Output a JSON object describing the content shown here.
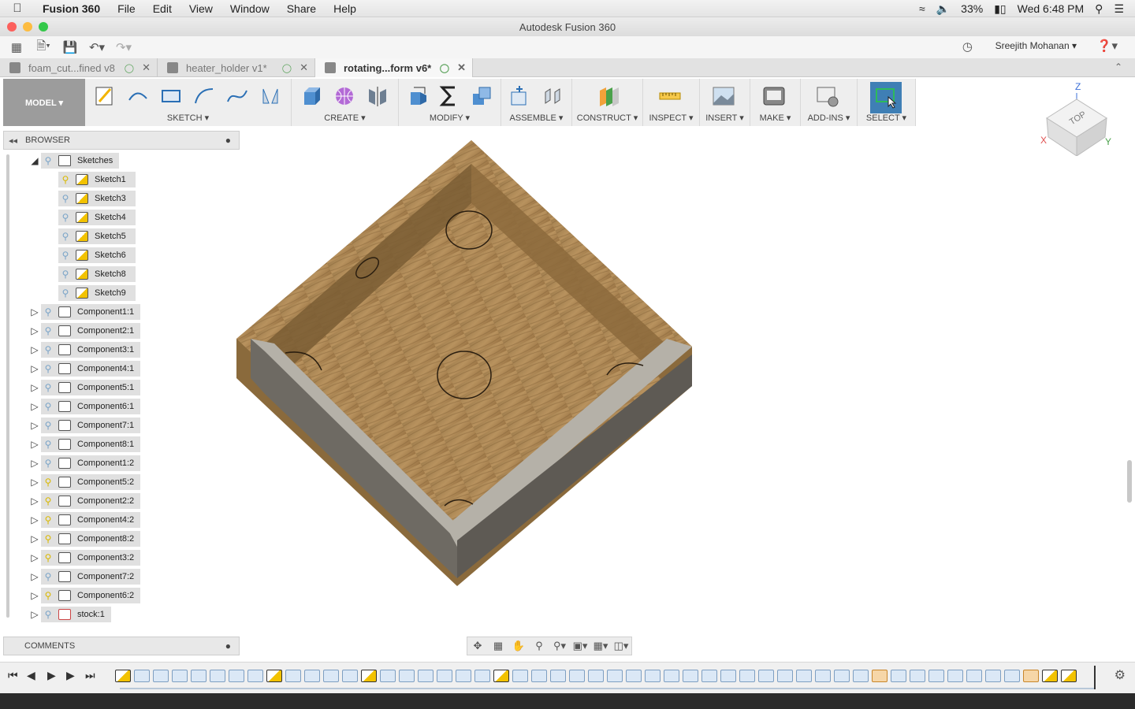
{
  "menubar": {
    "app_name": "Fusion 360",
    "items": [
      "File",
      "Edit",
      "View",
      "Window",
      "Share",
      "Help"
    ],
    "battery": "33%",
    "clock": "Wed 6:48 PM"
  },
  "window": {
    "title": "Autodesk Fusion 360"
  },
  "user": {
    "name": "Sreejith Mohanan ▾"
  },
  "tabs": [
    {
      "label": "foam_cut...fined v8"
    },
    {
      "label": "heater_holder v1*"
    },
    {
      "label": "rotating...form v6*"
    }
  ],
  "ribbon": {
    "workspace": "MODEL ▾",
    "groups": [
      {
        "label": "SKETCH ▾"
      },
      {
        "label": "CREATE ▾"
      },
      {
        "label": "MODIFY ▾"
      },
      {
        "label": "ASSEMBLE ▾"
      },
      {
        "label": "CONSTRUCT ▾"
      },
      {
        "label": "INSPECT ▾"
      },
      {
        "label": "INSERT ▾"
      },
      {
        "label": "MAKE ▾"
      },
      {
        "label": "ADD-INS ▾"
      },
      {
        "label": "SELECT ▾"
      }
    ]
  },
  "browser": {
    "title": "BROWSER",
    "folder": "Sketches",
    "sketches": [
      "Sketch1",
      "Sketch3",
      "Sketch4",
      "Sketch5",
      "Sketch6",
      "Sketch8",
      "Sketch9"
    ],
    "components": [
      {
        "label": "Component1:1",
        "visible": false
      },
      {
        "label": "Component2:1",
        "visible": false
      },
      {
        "label": "Component3:1",
        "visible": false
      },
      {
        "label": "Component4:1",
        "visible": false
      },
      {
        "label": "Component5:1",
        "visible": false
      },
      {
        "label": "Component6:1",
        "visible": false
      },
      {
        "label": "Component7:1",
        "visible": false
      },
      {
        "label": "Component8:1",
        "visible": false
      },
      {
        "label": "Component1:2",
        "visible": false
      },
      {
        "label": "Component5:2",
        "visible": true
      },
      {
        "label": "Component2:2",
        "visible": true
      },
      {
        "label": "Component4:2",
        "visible": true
      },
      {
        "label": "Component8:2",
        "visible": true
      },
      {
        "label": "Component3:2",
        "visible": true
      },
      {
        "label": "Component7:2",
        "visible": false
      },
      {
        "label": "Component6:2",
        "visible": true
      }
    ],
    "stock": "stock:1"
  },
  "comments": {
    "title": "COMMENTS"
  },
  "viewcube": {
    "face": "TOP",
    "axis_x": "X",
    "axis_y": "Y",
    "axis_z": "Z"
  },
  "colors": {
    "wood_light": "#b08a55",
    "wood_dark": "#8a6a3c",
    "wall_gray": "#b5b1a8",
    "wall_dark": "#6e6a63",
    "select_blue": "#3f7fb5"
  },
  "icons": {
    "timeline": [
      "skip-start-icon",
      "step-back-icon",
      "play-icon",
      "step-forward-icon",
      "skip-end-icon"
    ]
  }
}
